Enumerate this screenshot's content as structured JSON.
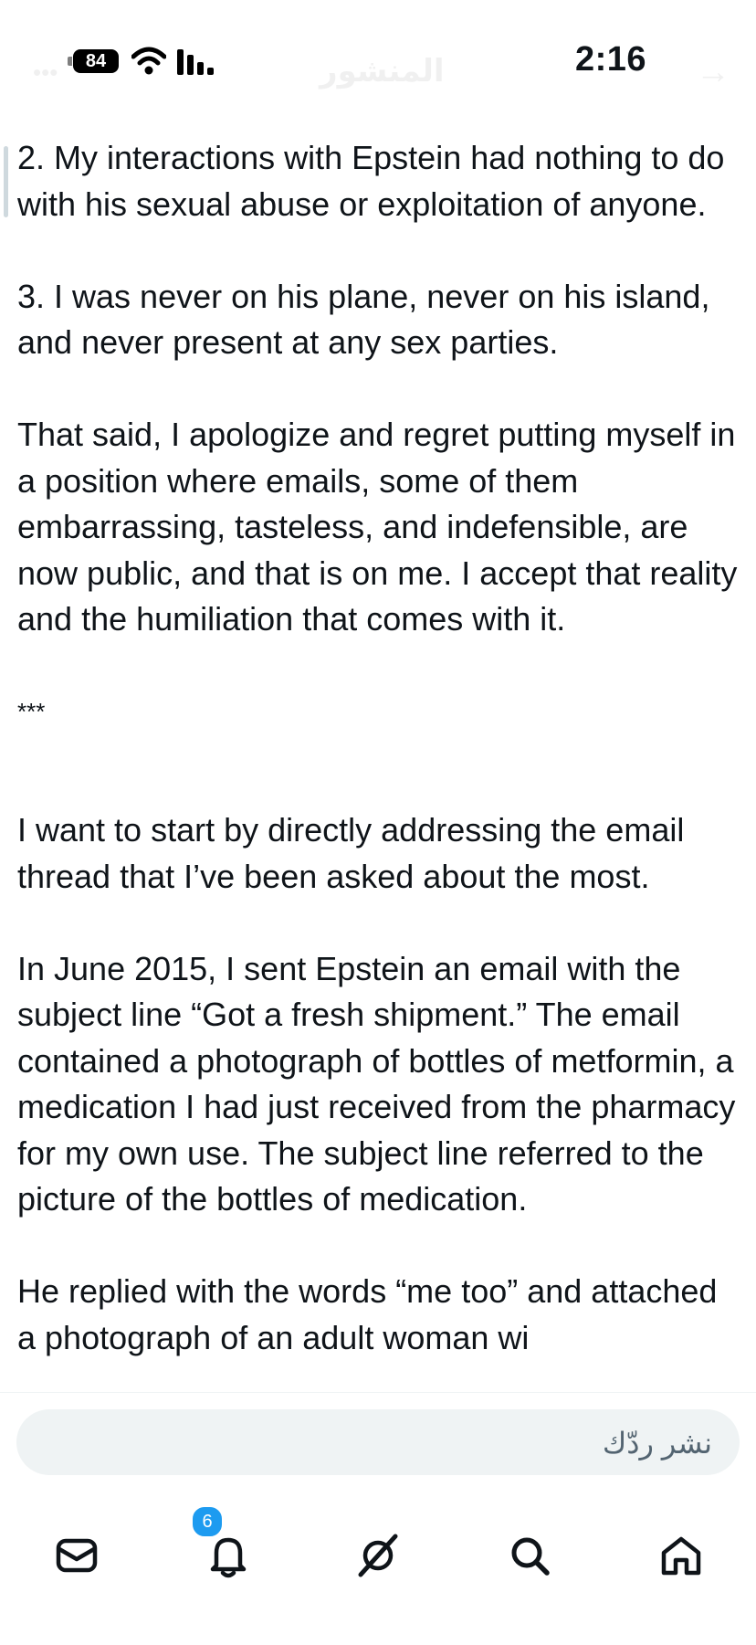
{
  "status_bar": {
    "battery": "84",
    "time": "2:16"
  },
  "header": {
    "title": "المنشور"
  },
  "article": {
    "paragraphs": [
      "2. My interactions with Epstein had nothing to do with his sexual abuse or exploitation of anyone.",
      "3. I was never on his plane, never on his island, and never present at any sex parties.",
      "That said, I apologize and regret putting myself in a position where emails, some of them embarrassing, tasteless, and indefensible, are now public, and that is on me. I accept that reality and the humiliation that comes with it.",
      "***",
      "I want to start by directly addressing the email thread that I’ve been asked about the most.",
      "In June 2015, I sent Epstein an email with the subject line “Got a fresh shipment.” The email contained a photograph of bottles of metformin, a medication I had just received from the pharmacy for my own use. The subject line referred to the picture of the bottles of medication.",
      "He replied with the words “me too” and attached a photograph of an adult woman wi"
    ]
  },
  "reply": {
    "placeholder": "نشر ردّك"
  },
  "nav": {
    "notifications_badge": "6",
    "icons": [
      "mail-icon",
      "bell-icon",
      "grok-icon",
      "search-icon",
      "home-icon"
    ]
  }
}
